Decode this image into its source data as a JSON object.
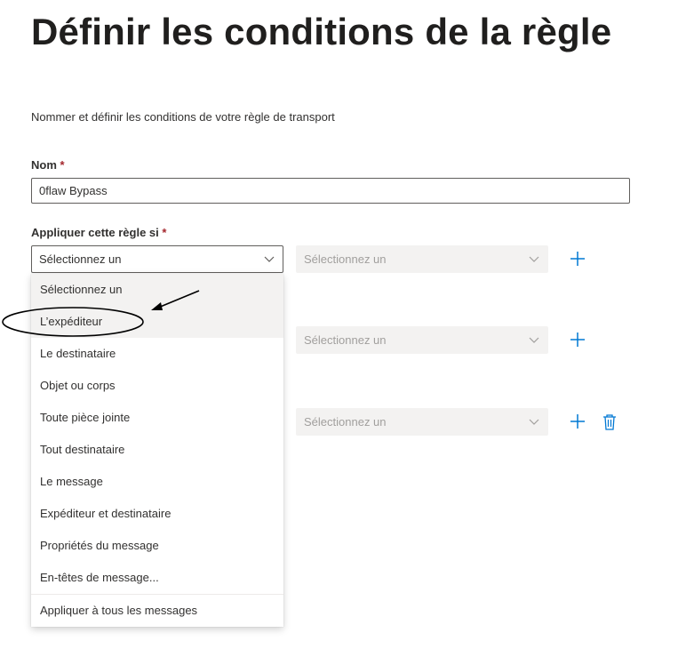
{
  "page": {
    "title": "Définir les conditions de la règle",
    "subtitle": "Nommer et définir les conditions de votre règle de transport"
  },
  "name_field": {
    "label": "Nom",
    "required_mark": "*",
    "value": "0flaw Bypass"
  },
  "condition": {
    "label": "Appliquer cette règle si",
    "required_mark": "*",
    "rows": [
      {
        "primary_value": "Sélectionnez un",
        "secondary_value": "Sélectionnez un"
      },
      {
        "secondary_value": "Sélectionnez un"
      },
      {
        "secondary_value": "Sélectionnez un"
      }
    ]
  },
  "dropdown_menu": {
    "items": [
      "Sélectionnez un",
      "L’expéditeur",
      "Le destinataire",
      "Objet ou corps",
      "Toute pièce jointe",
      "Tout destinataire",
      "Le message",
      "Expéditeur et destinataire",
      "Propriétés du message",
      "En-têtes de message..."
    ],
    "footer_item": "Appliquer à tous les messages",
    "selected_index": 0,
    "hovered_index": 1
  },
  "icons": {
    "add": "plus-icon",
    "delete": "trash-icon",
    "expand": "chevron-down-icon"
  },
  "colors": {
    "accent": "#0078d4",
    "required": "#a4262c",
    "disabled_bg": "#f3f2f1",
    "disabled_text": "#a19f9d"
  }
}
